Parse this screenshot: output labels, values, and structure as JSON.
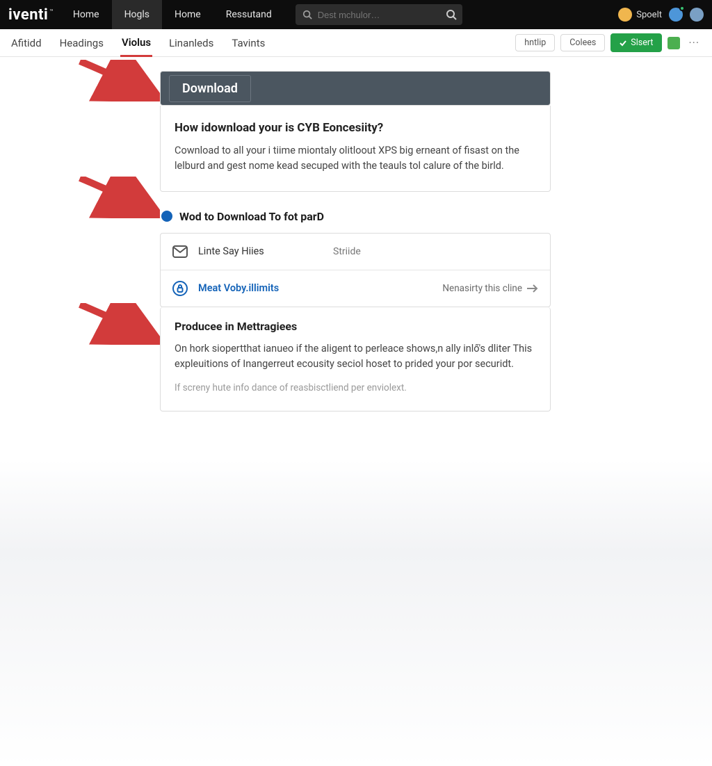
{
  "brand": "iventi",
  "brand_tm": "™",
  "topnav": [
    {
      "label": "Home"
    },
    {
      "label": "Hogls",
      "active": true
    },
    {
      "label": "Home"
    },
    {
      "label": "Ressutand"
    }
  ],
  "search": {
    "placeholder": "Dest mchulor…"
  },
  "user": {
    "name": "Spoelt"
  },
  "tabs": [
    {
      "label": "Afitidd"
    },
    {
      "label": "Headings"
    },
    {
      "label": "Violus",
      "active": true
    },
    {
      "label": "Linanleds"
    },
    {
      "label": "Tavints"
    }
  ],
  "toolbar": {
    "a": "hntlip",
    "b": "Colees",
    "c": "Slsert"
  },
  "download_chip": "Download",
  "intro": {
    "title": "How idownload your is CYB Eoncesiity?",
    "body": "Cownload to all your i tiime miontaly olitloout XPS big erneant of fisast on the lelburd and gest nome kead secuped with the teauls tol calure of the birld."
  },
  "linkrow": "Wod to Download To fot parD",
  "rows": [
    {
      "icon": "mail",
      "title": "Linte Say Hiies",
      "sub": "Striide"
    },
    {
      "icon": "lock",
      "title": "Meat Voby.illimits",
      "title_blue": true,
      "sub": "Nenasirty this cline",
      "cta": true
    }
  ],
  "block": {
    "title": "Producee in Mettragiees",
    "p1": "On hork siopertthat ianueo if the aligent to perleace shows,n ally inlő's dliter This expleuitions of Inangerreut ecousity seciol hoset to prided your por securidt.",
    "p2": "If screny hute info dance of reasbisctliend per enviolext."
  }
}
